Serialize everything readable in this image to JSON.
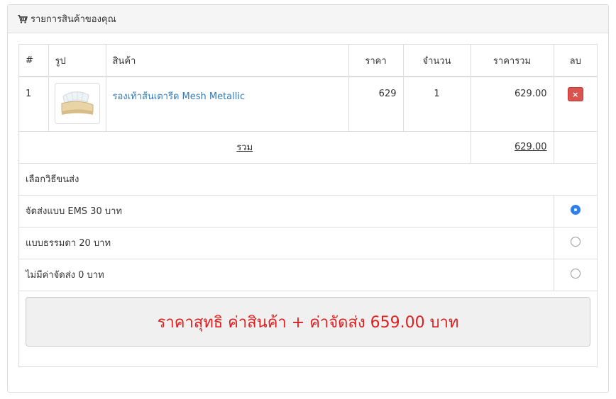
{
  "panel": {
    "icon": "cart-icon",
    "title": "รายการสินค้าของคุณ"
  },
  "table": {
    "headers": {
      "num": "#",
      "image": "รูป",
      "product": "สินค้า",
      "price": "ราคา",
      "qty": "จำนวน",
      "subtotal": "ราคารวม",
      "delete": "ลบ"
    },
    "items": [
      {
        "num": "1",
        "image_icon": "sandal-product-image",
        "name": "รองเท้าส้นเตารีด Mesh Metallic",
        "price": "629",
        "qty": "1",
        "subtotal": "629.00",
        "delete_icon": "close-icon",
        "delete_glyph": "×"
      }
    ],
    "total_label": "รวม",
    "total_value": "629.00"
  },
  "shipping": {
    "label": "เลือกวิธีขนส่ง",
    "options": [
      {
        "label": "จัดส่งแบบ EMS 30 บาท",
        "selected": true
      },
      {
        "label": "แบบธรรมดา 20 บาท",
        "selected": false
      },
      {
        "label": "ไม่มีค่าจัดส่ง 0 บาท",
        "selected": false
      }
    ]
  },
  "summary": {
    "text": "ราคาสุทธิ ค่าสินค้า + ค่าจัดส่ง 659.00 บาท"
  },
  "colors": {
    "link": "#337ab7",
    "delete_button": "#d9534f",
    "radio_selected": "#2f80ed",
    "summary_text": "#dd1f1f"
  }
}
